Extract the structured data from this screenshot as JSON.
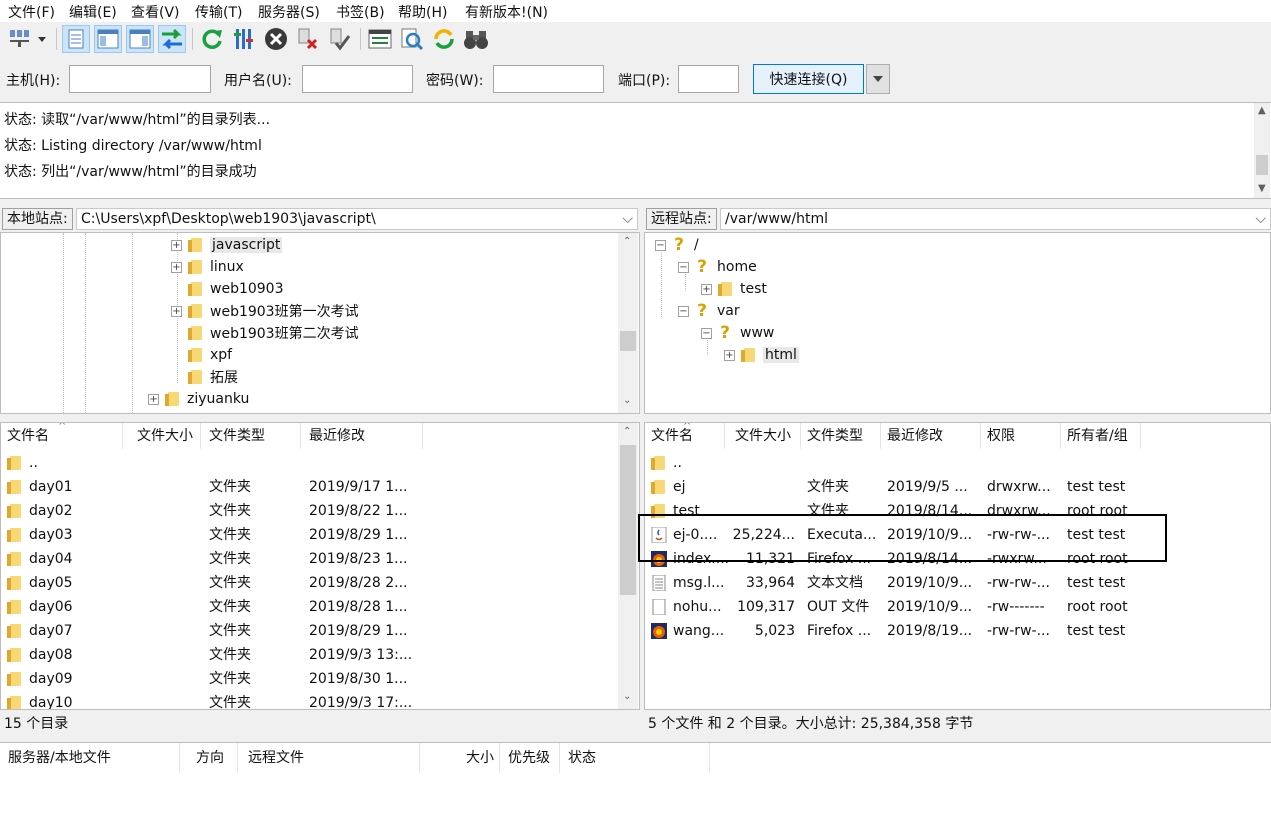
{
  "menu": [
    "文件(F)",
    "编辑(E)",
    "查看(V)",
    "传输(T)",
    "服务器(S)",
    "书签(B)",
    "帮助(H)",
    "有新版本!(N)"
  ],
  "quickconnect": {
    "host_label": "主机(H):",
    "user_label": "用户名(U):",
    "pass_label": "密码(W):",
    "port_label": "端口(P):",
    "host_value": "",
    "user_value": "",
    "pass_value": "",
    "port_value": "",
    "button_label": "快速连接(Q)"
  },
  "log": [
    "状态:  读取“/var/www/html”的目录列表...",
    "状态:  Listing directory /var/www/html",
    "状态:  列出“/var/www/html”的目录成功"
  ],
  "local": {
    "site_label": "本地站点:",
    "path": "C:\\Users\\xpf\\Desktop\\web1903\\javascript\\",
    "tree": [
      {
        "label": "javascript",
        "expander": "+",
        "selected": true
      },
      {
        "label": "linux",
        "expander": "+"
      },
      {
        "label": "web10903",
        "expander": ""
      },
      {
        "label": "web1903班第一次考试",
        "expander": "+"
      },
      {
        "label": "web1903班第二次考试",
        "expander": ""
      },
      {
        "label": "xpf",
        "expander": ""
      },
      {
        "label": "拓展",
        "expander": ""
      },
      {
        "label": "ziyuanku",
        "expander": "+"
      }
    ],
    "headers": [
      "文件名",
      "文件大小",
      "文件类型",
      "最近修改"
    ],
    "files": [
      {
        "name": "..",
        "size": "",
        "type": "",
        "modified": ""
      },
      {
        "name": "day01",
        "size": "",
        "type": "文件夹",
        "modified": "2019/9/17 1..."
      },
      {
        "name": "day02",
        "size": "",
        "type": "文件夹",
        "modified": "2019/8/22 1..."
      },
      {
        "name": "day03",
        "size": "",
        "type": "文件夹",
        "modified": "2019/8/29 1..."
      },
      {
        "name": "day04",
        "size": "",
        "type": "文件夹",
        "modified": "2019/8/23 1..."
      },
      {
        "name": "day05",
        "size": "",
        "type": "文件夹",
        "modified": "2019/8/28 2..."
      },
      {
        "name": "day06",
        "size": "",
        "type": "文件夹",
        "modified": "2019/8/28 1..."
      },
      {
        "name": "day07",
        "size": "",
        "type": "文件夹",
        "modified": "2019/8/29 1..."
      },
      {
        "name": "day08",
        "size": "",
        "type": "文件夹",
        "modified": "2019/9/3 13:..."
      },
      {
        "name": "day09",
        "size": "",
        "type": "文件夹",
        "modified": "2019/8/30 1..."
      },
      {
        "name": "day10",
        "size": "",
        "type": "文件夹",
        "modified": "2019/9/3 17:..."
      }
    ],
    "status": "15 个目录"
  },
  "remote": {
    "site_label": "远程站点:",
    "path": "/var/www/html",
    "tree": [
      {
        "label": "/",
        "icon": "unknown",
        "expander": "-",
        "level": 0
      },
      {
        "label": "home",
        "icon": "unknown",
        "expander": "-",
        "level": 1
      },
      {
        "label": "test",
        "icon": "folder",
        "expander": "+",
        "level": 2
      },
      {
        "label": "var",
        "icon": "unknown",
        "expander": "-",
        "level": 1
      },
      {
        "label": "www",
        "icon": "unknown",
        "expander": "-",
        "level": 2
      },
      {
        "label": "html",
        "icon": "folder",
        "expander": "+",
        "level": 3
      }
    ],
    "headers": [
      "文件名",
      "文件大小",
      "文件类型",
      "最近修改",
      "权限",
      "所有者/组"
    ],
    "files": [
      {
        "name": "..",
        "size": "",
        "type": "",
        "modified": "",
        "perms": "",
        "owner": "",
        "icon": "folder"
      },
      {
        "name": "ej",
        "size": "",
        "type": "文件夹",
        "modified": "2019/9/5 ...",
        "perms": "drwxrw...",
        "owner": "test test",
        "icon": "folder"
      },
      {
        "name": "test",
        "size": "",
        "type": "文件夹",
        "modified": "2019/8/14...",
        "perms": "drwxrw...",
        "owner": "root root",
        "icon": "folder"
      },
      {
        "name": "ej-0....",
        "size": "25,224...",
        "type": "Executa...",
        "modified": "2019/10/9...",
        "perms": "-rw-rw-...",
        "owner": "test test",
        "icon": "java"
      },
      {
        "name": "index....",
        "size": "11,321",
        "type": "Firefox ...",
        "modified": "2019/8/14...",
        "perms": "-rwxrw...",
        "owner": "root root",
        "icon": "firefox"
      },
      {
        "name": "msg.l...",
        "size": "33,964",
        "type": "文本文档",
        "modified": "2019/10/9...",
        "perms": "-rw-rw-...",
        "owner": "test test",
        "icon": "text"
      },
      {
        "name": "nohu...",
        "size": "109,317",
        "type": "OUT 文件",
        "modified": "2019/10/9...",
        "perms": "-rw-------",
        "owner": "root root",
        "icon": "blank"
      },
      {
        "name": "wang...",
        "size": "5,023",
        "type": "Firefox ...",
        "modified": "2019/8/19...",
        "perms": "-rw-rw-...",
        "owner": "test test",
        "icon": "firefox"
      }
    ],
    "status": "5 个文件 和 2 个目录。大小总计: 25,384,358 字节"
  },
  "queue": {
    "headers": [
      "服务器/本地文件",
      "方向",
      "远程文件",
      "大小",
      "优先级",
      "状态"
    ]
  }
}
